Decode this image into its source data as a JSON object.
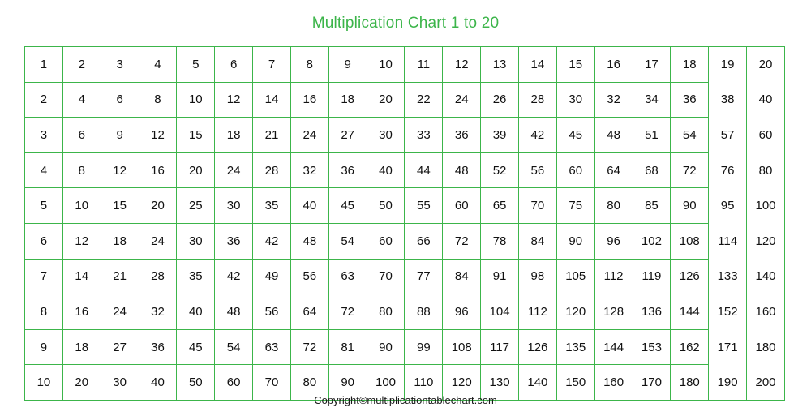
{
  "page": {
    "title": "Multiplication Chart 1 to 20",
    "copyright": "Copyright©multiplicationtablechart.com",
    "accent_color": "#3cb54a",
    "text_color": "#111111",
    "background_color": "#ffffff"
  },
  "chart_data": {
    "type": "table",
    "title": "Multiplication Chart 1 to 20",
    "xlabel": "",
    "ylabel": "",
    "rows_count": 10,
    "columns_count": 20,
    "columns": [
      1,
      2,
      3,
      4,
      5,
      6,
      7,
      8,
      9,
      10,
      11,
      12,
      13,
      14,
      15,
      16,
      17,
      18,
      19,
      20
    ],
    "row_factors": [
      1,
      2,
      3,
      4,
      5,
      6,
      7,
      8,
      9,
      10
    ],
    "borderless_row_divider_columns": [
      19,
      20
    ],
    "values": [
      [
        1,
        2,
        3,
        4,
        5,
        6,
        7,
        8,
        9,
        10,
        11,
        12,
        13,
        14,
        15,
        16,
        17,
        18,
        19,
        20
      ],
      [
        2,
        4,
        6,
        8,
        10,
        12,
        14,
        16,
        18,
        20,
        22,
        24,
        26,
        28,
        30,
        32,
        34,
        36,
        38,
        40
      ],
      [
        3,
        6,
        9,
        12,
        15,
        18,
        21,
        24,
        27,
        30,
        33,
        36,
        39,
        42,
        45,
        48,
        51,
        54,
        57,
        60
      ],
      [
        4,
        8,
        12,
        16,
        20,
        24,
        28,
        32,
        36,
        40,
        44,
        48,
        52,
        56,
        60,
        64,
        68,
        72,
        76,
        80
      ],
      [
        5,
        10,
        15,
        20,
        25,
        30,
        35,
        40,
        45,
        50,
        55,
        60,
        65,
        70,
        75,
        80,
        85,
        90,
        95,
        100
      ],
      [
        6,
        12,
        18,
        24,
        30,
        36,
        42,
        48,
        54,
        60,
        66,
        72,
        78,
        84,
        90,
        96,
        102,
        108,
        114,
        120
      ],
      [
        7,
        14,
        21,
        28,
        35,
        42,
        49,
        56,
        63,
        70,
        77,
        84,
        91,
        98,
        105,
        112,
        119,
        126,
        133,
        140
      ],
      [
        8,
        16,
        24,
        32,
        40,
        48,
        56,
        64,
        72,
        80,
        88,
        96,
        104,
        112,
        120,
        128,
        136,
        144,
        152,
        160
      ],
      [
        9,
        18,
        27,
        36,
        45,
        54,
        63,
        72,
        81,
        90,
        99,
        108,
        117,
        126,
        135,
        144,
        153,
        162,
        171,
        180
      ],
      [
        10,
        20,
        30,
        40,
        50,
        60,
        70,
        80,
        90,
        100,
        110,
        120,
        130,
        140,
        150,
        160,
        170,
        180,
        190,
        200
      ]
    ]
  }
}
